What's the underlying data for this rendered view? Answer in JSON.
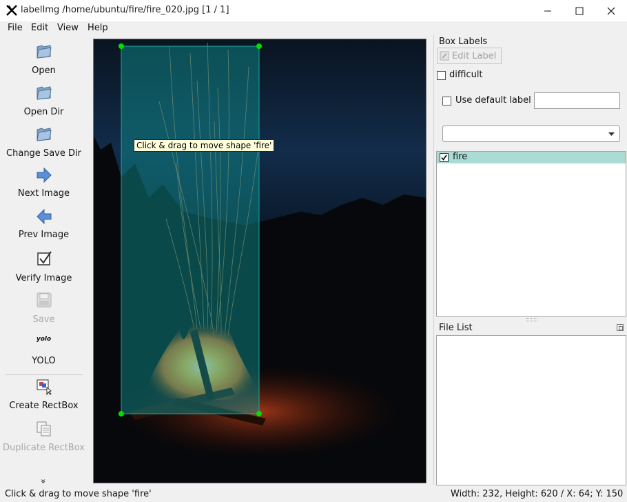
{
  "window": {
    "title": "labelImg /home/ubuntu/fire/fire_020.jpg [1 / 1]",
    "controls": [
      "minimize",
      "maximize",
      "close"
    ]
  },
  "menu": {
    "items": [
      "File",
      "Edit",
      "View",
      "Help"
    ]
  },
  "toolbar": {
    "open": "Open",
    "open_dir": "Open Dir",
    "change_save_dir": "Change Save Dir",
    "next_image": "Next Image",
    "prev_image": "Prev Image",
    "verify_image": "Verify Image",
    "save": "Save",
    "yolo_icon_text": "yolo",
    "yolo": "YOLO",
    "create_rectbox": "Create RectBox",
    "duplicate_rectbox": "Duplicate RectBox",
    "more": "»"
  },
  "canvas": {
    "tooltip": "Click & drag to move shape 'fire'",
    "shape_label": "fire",
    "shape_fill": "#0e8a8a",
    "handle_color": "#00e000"
  },
  "box_labels": {
    "title": "Box Labels",
    "edit_label_button": "Edit Label",
    "difficult_label": "difficult",
    "difficult_checked": false,
    "use_default_label": "Use default label",
    "use_default_checked": false,
    "default_label_value": "",
    "combo_value": "",
    "labels": [
      {
        "name": "fire",
        "checked": true,
        "color": "#a8dcd4"
      }
    ]
  },
  "file_list": {
    "title": "File List",
    "files": []
  },
  "status": {
    "message": "Click & drag to move shape 'fire'",
    "info": "Width: 232, Height: 620 / X: 64; Y: 150"
  }
}
